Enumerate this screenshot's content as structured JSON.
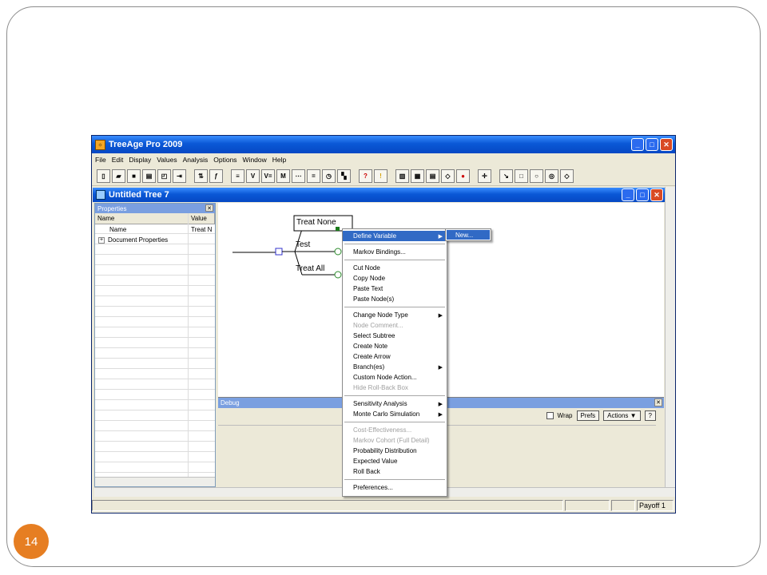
{
  "slide": {
    "page_number": "14"
  },
  "window": {
    "title": "TreeAge Pro 2009",
    "menu": [
      "File",
      "Edit",
      "Display",
      "Values",
      "Analysis",
      "Options",
      "Window",
      "Help"
    ]
  },
  "document": {
    "title": "Untitled Tree 7"
  },
  "properties": {
    "title": "Properties",
    "columns": [
      "Name",
      "Value"
    ],
    "rows": [
      {
        "name": "Name",
        "value": "Treat N"
      },
      {
        "name": "Document Properties",
        "value": "",
        "expander": "+"
      }
    ]
  },
  "tree": {
    "branches": [
      "Treat None",
      "Test",
      "Treat All"
    ]
  },
  "debug": {
    "title": "Debug",
    "wrap_label": "Wrap",
    "prefs_label": "Prefs",
    "actions_label": "Actions ▼",
    "help_label": "?"
  },
  "status": {
    "payoff": "Payoff 1"
  },
  "context_menu": {
    "items": [
      {
        "label": "Define Variable",
        "submenu": true,
        "selected": true
      },
      {
        "sep": true
      },
      {
        "label": "Markov Bindings..."
      },
      {
        "sep": true
      },
      {
        "label": "Cut Node"
      },
      {
        "label": "Copy Node"
      },
      {
        "label": "Paste Text"
      },
      {
        "label": "Paste Node(s)"
      },
      {
        "sep": true
      },
      {
        "label": "Change Node Type",
        "submenu": true
      },
      {
        "label": "Node Comment...",
        "disabled": true
      },
      {
        "label": "Select Subtree"
      },
      {
        "label": "Create Note"
      },
      {
        "label": "Create Arrow"
      },
      {
        "label": "Branch(es)",
        "submenu": true
      },
      {
        "label": "Custom Node Action..."
      },
      {
        "label": "Hide Roll-Back Box",
        "disabled": true
      },
      {
        "sep": true
      },
      {
        "label": "Sensitivity Analysis",
        "submenu": true
      },
      {
        "label": "Monte Carlo Simulation",
        "submenu": true
      },
      {
        "sep": true
      },
      {
        "label": "Cost-Effectiveness...",
        "disabled": true
      },
      {
        "label": "Markov Cohort (Full Detail)",
        "disabled": true
      },
      {
        "label": "Probability Distribution"
      },
      {
        "label": "Expected Value"
      },
      {
        "label": "Roll Back"
      },
      {
        "sep": true
      },
      {
        "label": "Preferences..."
      }
    ],
    "submenu_item": "New..."
  },
  "colors": {
    "accent": "#e67e22",
    "titlebar": "#0a58d6",
    "selection": "#316ac5"
  }
}
